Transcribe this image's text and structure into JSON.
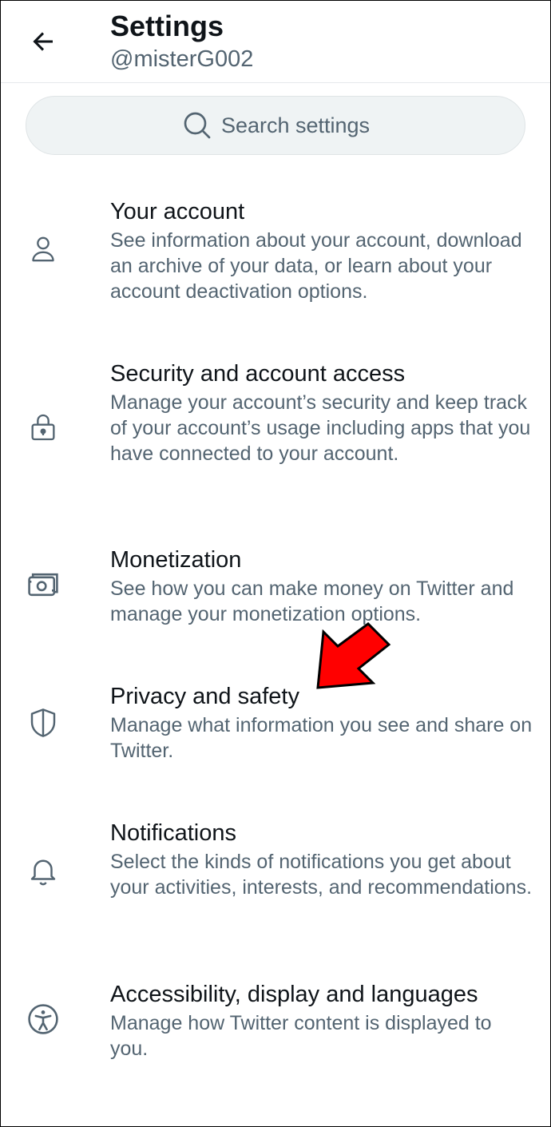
{
  "header": {
    "back_icon": "arrow-left-icon",
    "title": "Settings",
    "handle": "@misterG002"
  },
  "search": {
    "icon": "search-icon",
    "placeholder": "Search settings"
  },
  "items": [
    {
      "icon": "user-icon",
      "title": "Your account",
      "description": "See information about your account, download an archive of your data, or learn about your account deactivation options."
    },
    {
      "icon": "lock-icon",
      "title": "Security and account access",
      "description": "Manage your account’s security and keep track of your account’s usage including apps that you have connected to your account."
    },
    {
      "icon": "money-icon",
      "title": "Monetization",
      "description": "See how you can make money on Twitter and manage your monetization options."
    },
    {
      "icon": "shield-icon",
      "title": "Privacy and safety",
      "description": "Manage what information you see and share on Twitter."
    },
    {
      "icon": "bell-icon",
      "title": "Notifications",
      "description": "Select the kinds of notifications you get about your activities, interests, and recommendations."
    },
    {
      "icon": "accessibility-icon",
      "title": "Accessibility, display and languages",
      "description": "Manage how Twitter content is displayed to you."
    }
  ],
  "annotation": {
    "icon": "red-pointer-arrow-icon",
    "color": "#ff0000"
  }
}
